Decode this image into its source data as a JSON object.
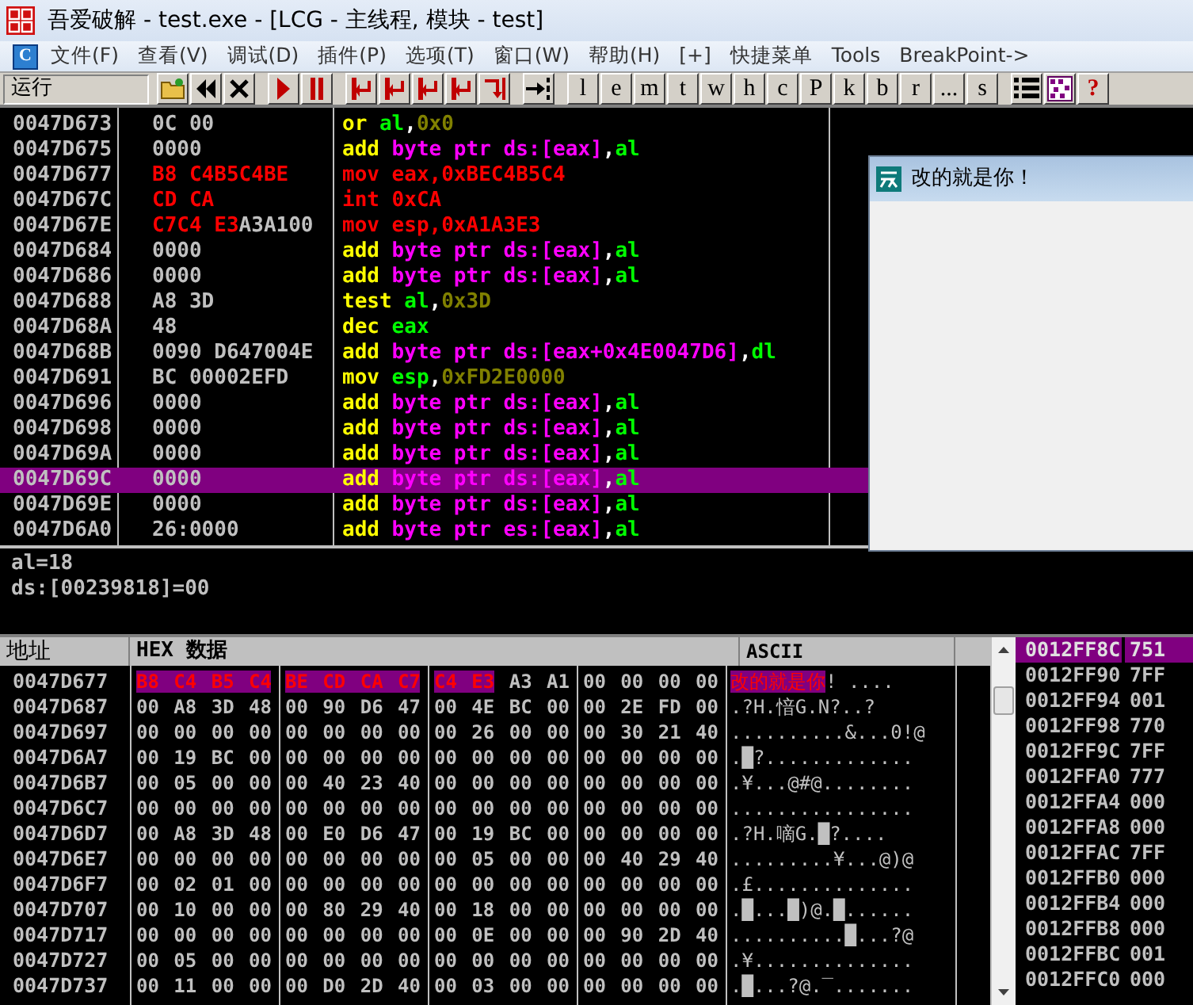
{
  "window": {
    "title": "吾爱破解 - test.exe - [LCG - 主线程, 模块 - test]"
  },
  "menu": {
    "logo": "C",
    "items": [
      "文件(F)",
      "查看(V)",
      "调试(D)",
      "插件(P)",
      "选项(T)",
      "窗口(W)",
      "帮助(H)",
      "[+]",
      "快捷菜单",
      "Tools",
      "BreakPoint->"
    ]
  },
  "toolbar": {
    "status": "运行",
    "groups": [
      [
        {
          "kind": "folder"
        },
        {
          "kind": "rewind"
        },
        {
          "kind": "cross"
        }
      ],
      [
        {
          "kind": "play"
        },
        {
          "kind": "pause"
        }
      ],
      [
        {
          "kind": "step"
        },
        {
          "kind": "step"
        },
        {
          "kind": "step"
        },
        {
          "kind": "step"
        },
        {
          "kind": "return"
        }
      ],
      [
        {
          "kind": "jump"
        }
      ],
      [
        {
          "kind": "letter",
          "label": "l"
        },
        {
          "kind": "letter",
          "label": "e"
        },
        {
          "kind": "letter",
          "label": "m"
        },
        {
          "kind": "letter",
          "label": "t"
        },
        {
          "kind": "letter",
          "label": "w"
        },
        {
          "kind": "letter",
          "label": "h"
        },
        {
          "kind": "letter",
          "label": "c"
        },
        {
          "kind": "letter",
          "label": "P"
        },
        {
          "kind": "letter",
          "label": "k"
        },
        {
          "kind": "letter",
          "label": "b"
        },
        {
          "kind": "letter",
          "label": "r"
        },
        {
          "kind": "letter",
          "label": "..."
        },
        {
          "kind": "letter",
          "label": "s"
        }
      ],
      [
        {
          "kind": "list"
        },
        {
          "kind": "grid"
        },
        {
          "kind": "help",
          "label": "?"
        }
      ]
    ]
  },
  "disasm": {
    "rows": [
      {
        "address": "0047D673",
        "hex": [
          {
            "text": "0C 00",
            "modified": false
          }
        ],
        "modified": false,
        "selected": false,
        "tokens": [
          {
            "text": "or",
            "kind": "op"
          },
          {
            "text": "al",
            "kind": "reg"
          },
          {
            "text": ",",
            "kind": "sep"
          },
          {
            "text": "0x0",
            "kind": "imm"
          }
        ]
      },
      {
        "address": "0047D675",
        "hex": [
          {
            "text": "0000",
            "modified": false
          }
        ],
        "modified": false,
        "selected": false,
        "tokens": [
          {
            "text": "add",
            "kind": "op"
          },
          {
            "text": "byte ptr ds:[eax]",
            "kind": "mem"
          },
          {
            "text": ",",
            "kind": "sep"
          },
          {
            "text": "al",
            "kind": "reg"
          }
        ]
      },
      {
        "address": "0047D677",
        "hex": [
          {
            "text": "B8 C4B5C4BE",
            "modified": true
          }
        ],
        "modified": true,
        "selected": false,
        "tokens": [
          {
            "text": "mov",
            "kind": "op"
          },
          {
            "text": "eax",
            "kind": "reg"
          },
          {
            "text": ",",
            "kind": "sep"
          },
          {
            "text": "0xBEC4B5C4",
            "kind": "imm"
          }
        ]
      },
      {
        "address": "0047D67C",
        "hex": [
          {
            "text": "CD CA",
            "modified": true
          }
        ],
        "modified": true,
        "selected": false,
        "tokens": [
          {
            "text": "int",
            "kind": "op"
          },
          {
            "text": "0xCA",
            "kind": "imm"
          }
        ]
      },
      {
        "address": "0047D67E",
        "hex": [
          {
            "text": "C7C4 E3",
            "modified": true
          },
          {
            "text": "A3A100",
            "modified": false
          }
        ],
        "modified": true,
        "selected": false,
        "tokens": [
          {
            "text": "mov",
            "kind": "op"
          },
          {
            "text": "esp",
            "kind": "reg"
          },
          {
            "text": ",",
            "kind": "sep"
          },
          {
            "text": "0xA1A3E3",
            "kind": "imm"
          }
        ]
      },
      {
        "address": "0047D684",
        "hex": [
          {
            "text": "0000",
            "modified": false
          }
        ],
        "modified": false,
        "selected": false,
        "tokens": [
          {
            "text": "add",
            "kind": "op"
          },
          {
            "text": "byte ptr ds:[eax]",
            "kind": "mem"
          },
          {
            "text": ",",
            "kind": "sep"
          },
          {
            "text": "al",
            "kind": "reg"
          }
        ]
      },
      {
        "address": "0047D686",
        "hex": [
          {
            "text": "0000",
            "modified": false
          }
        ],
        "modified": false,
        "selected": false,
        "tokens": [
          {
            "text": "add",
            "kind": "op"
          },
          {
            "text": "byte ptr ds:[eax]",
            "kind": "mem"
          },
          {
            "text": ",",
            "kind": "sep"
          },
          {
            "text": "al",
            "kind": "reg"
          }
        ]
      },
      {
        "address": "0047D688",
        "hex": [
          {
            "text": "A8 3D",
            "modified": false
          }
        ],
        "modified": false,
        "selected": false,
        "tokens": [
          {
            "text": "test",
            "kind": "op"
          },
          {
            "text": "al",
            "kind": "reg"
          },
          {
            "text": ",",
            "kind": "sep"
          },
          {
            "text": "0x3D",
            "kind": "imm"
          }
        ]
      },
      {
        "address": "0047D68A",
        "hex": [
          {
            "text": "48",
            "modified": false
          }
        ],
        "modified": false,
        "selected": false,
        "tokens": [
          {
            "text": "dec",
            "kind": "op"
          },
          {
            "text": "eax",
            "kind": "reg"
          }
        ]
      },
      {
        "address": "0047D68B",
        "hex": [
          {
            "text": "0090 D647004E",
            "modified": false
          }
        ],
        "modified": false,
        "selected": false,
        "tokens": [
          {
            "text": "add",
            "kind": "op"
          },
          {
            "text": "byte ptr ds:[eax+0x4E0047D6]",
            "kind": "mem"
          },
          {
            "text": ",",
            "kind": "sep"
          },
          {
            "text": "dl",
            "kind": "reg"
          }
        ]
      },
      {
        "address": "0047D691",
        "hex": [
          {
            "text": "BC 00002EFD",
            "modified": false
          }
        ],
        "modified": false,
        "selected": false,
        "tokens": [
          {
            "text": "mov",
            "kind": "op"
          },
          {
            "text": "esp",
            "kind": "reg"
          },
          {
            "text": ",",
            "kind": "sep"
          },
          {
            "text": "0xFD2E0000",
            "kind": "imm"
          }
        ]
      },
      {
        "address": "0047D696",
        "hex": [
          {
            "text": "0000",
            "modified": false
          }
        ],
        "modified": false,
        "selected": false,
        "tokens": [
          {
            "text": "add",
            "kind": "op"
          },
          {
            "text": "byte ptr ds:[eax]",
            "kind": "mem"
          },
          {
            "text": ",",
            "kind": "sep"
          },
          {
            "text": "al",
            "kind": "reg"
          }
        ]
      },
      {
        "address": "0047D698",
        "hex": [
          {
            "text": "0000",
            "modified": false
          }
        ],
        "modified": false,
        "selected": false,
        "tokens": [
          {
            "text": "add",
            "kind": "op"
          },
          {
            "text": "byte ptr ds:[eax]",
            "kind": "mem"
          },
          {
            "text": ",",
            "kind": "sep"
          },
          {
            "text": "al",
            "kind": "reg"
          }
        ]
      },
      {
        "address": "0047D69A",
        "hex": [
          {
            "text": "0000",
            "modified": false
          }
        ],
        "modified": false,
        "selected": false,
        "tokens": [
          {
            "text": "add",
            "kind": "op"
          },
          {
            "text": "byte ptr ds:[eax]",
            "kind": "mem"
          },
          {
            "text": ",",
            "kind": "sep"
          },
          {
            "text": "al",
            "kind": "reg"
          }
        ]
      },
      {
        "address": "0047D69C",
        "hex": [
          {
            "text": "0000",
            "modified": false
          }
        ],
        "modified": false,
        "selected": true,
        "tokens": [
          {
            "text": "add",
            "kind": "op"
          },
          {
            "text": "byte ptr ds:[eax]",
            "kind": "mem"
          },
          {
            "text": ",",
            "kind": "sep"
          },
          {
            "text": "al",
            "kind": "reg"
          }
        ]
      },
      {
        "address": "0047D69E",
        "hex": [
          {
            "text": "0000",
            "modified": false
          }
        ],
        "modified": false,
        "selected": false,
        "tokens": [
          {
            "text": "add",
            "kind": "op"
          },
          {
            "text": "byte ptr ds:[eax]",
            "kind": "mem"
          },
          {
            "text": ",",
            "kind": "sep"
          },
          {
            "text": "al",
            "kind": "reg"
          }
        ]
      },
      {
        "address": "0047D6A0",
        "hex": [
          {
            "text": "26:0000",
            "modified": false
          }
        ],
        "modified": false,
        "selected": false,
        "tokens": [
          {
            "text": "add",
            "kind": "op"
          },
          {
            "text": "byte ptr es:[eax]",
            "kind": "mem"
          },
          {
            "text": ",",
            "kind": "sep"
          },
          {
            "text": "al",
            "kind": "reg"
          }
        ]
      }
    ]
  },
  "info": [
    "al=18",
    "ds:[00239818]=00"
  ],
  "dump": {
    "columns": [
      "地址",
      "HEX 数据",
      "ASCII"
    ],
    "rows": [
      {
        "address": "0047D677",
        "groups": [
          [
            {
              "text": "B8 C4 B5 C4",
              "modified": true
            }
          ],
          [
            {
              "text": "BE CD CA C7",
              "modified": true
            }
          ],
          [
            {
              "text": "C4 E3",
              "modified": true
            },
            {
              "text": "A3 A1",
              "modified": false
            }
          ],
          [
            {
              "text": "00 00 00 00",
              "modified": false
            }
          ]
        ],
        "ascii": [
          {
            "text": "改的就是你",
            "modified": true
          },
          {
            "text": "! ....",
            "modified": false
          }
        ]
      },
      {
        "address": "0047D687",
        "groups": [
          [
            {
              "text": "00 A8 3D 48",
              "modified": false
            }
          ],
          [
            {
              "text": "00 90 D6 47",
              "modified": false
            }
          ],
          [
            {
              "text": "00 4E BC 00",
              "modified": false
            }
          ],
          [
            {
              "text": "00 2E FD 00",
              "modified": false
            }
          ]
        ],
        "ascii": [
          {
            "text": ".?H.愔G.N?..?",
            "modified": false
          }
        ]
      },
      {
        "address": "0047D697",
        "groups": [
          [
            {
              "text": "00 00 00 00",
              "modified": false
            }
          ],
          [
            {
              "text": "00 00 00 00",
              "modified": false
            }
          ],
          [
            {
              "text": "00 26 00 00",
              "modified": false
            }
          ],
          [
            {
              "text": "00 30 21 40",
              "modified": false
            }
          ]
        ],
        "ascii": [
          {
            "text": "..........&...0!@",
            "modified": false
          }
        ]
      },
      {
        "address": "0047D6A7",
        "groups": [
          [
            {
              "text": "00 19 BC 00",
              "modified": false
            }
          ],
          [
            {
              "text": "00 00 00 00",
              "modified": false
            }
          ],
          [
            {
              "text": "00 00 00 00",
              "modified": false
            }
          ],
          [
            {
              "text": "00 00 00 00",
              "modified": false
            }
          ]
        ],
        "ascii": [
          {
            "text": ".█?.............",
            "modified": false
          }
        ]
      },
      {
        "address": "0047D6B7",
        "groups": [
          [
            {
              "text": "00 05 00 00",
              "modified": false
            }
          ],
          [
            {
              "text": "00 40 23 40",
              "modified": false
            }
          ],
          [
            {
              "text": "00 00 00 00",
              "modified": false
            }
          ],
          [
            {
              "text": "00 00 00 00",
              "modified": false
            }
          ]
        ],
        "ascii": [
          {
            "text": ".¥...@#@........",
            "modified": false
          }
        ]
      },
      {
        "address": "0047D6C7",
        "groups": [
          [
            {
              "text": "00 00 00 00",
              "modified": false
            }
          ],
          [
            {
              "text": "00 00 00 00",
              "modified": false
            }
          ],
          [
            {
              "text": "00 00 00 00",
              "modified": false
            }
          ],
          [
            {
              "text": "00 00 00 00",
              "modified": false
            }
          ]
        ],
        "ascii": [
          {
            "text": "................",
            "modified": false
          }
        ]
      },
      {
        "address": "0047D6D7",
        "groups": [
          [
            {
              "text": "00 A8 3D 48",
              "modified": false
            }
          ],
          [
            {
              "text": "00 E0 D6 47",
              "modified": false
            }
          ],
          [
            {
              "text": "00 19 BC 00",
              "modified": false
            }
          ],
          [
            {
              "text": "00 00 00 00",
              "modified": false
            }
          ]
        ],
        "ascii": [
          {
            "text": ".?H.嘀G.█?....",
            "modified": false
          }
        ]
      },
      {
        "address": "0047D6E7",
        "groups": [
          [
            {
              "text": "00 00 00 00",
              "modified": false
            }
          ],
          [
            {
              "text": "00 00 00 00",
              "modified": false
            }
          ],
          [
            {
              "text": "00 05 00 00",
              "modified": false
            }
          ],
          [
            {
              "text": "00 40 29 40",
              "modified": false
            }
          ]
        ],
        "ascii": [
          {
            "text": ".........¥...@)@",
            "modified": false
          }
        ]
      },
      {
        "address": "0047D6F7",
        "groups": [
          [
            {
              "text": "00 02 01 00",
              "modified": false
            }
          ],
          [
            {
              "text": "00 00 00 00",
              "modified": false
            }
          ],
          [
            {
              "text": "00 00 00 00",
              "modified": false
            }
          ],
          [
            {
              "text": "00 00 00 00",
              "modified": false
            }
          ]
        ],
        "ascii": [
          {
            "text": ".£..............",
            "modified": false
          }
        ]
      },
      {
        "address": "0047D707",
        "groups": [
          [
            {
              "text": "00 10 00 00",
              "modified": false
            }
          ],
          [
            {
              "text": "00 80 29 40",
              "modified": false
            }
          ],
          [
            {
              "text": "00 18 00 00",
              "modified": false
            }
          ],
          [
            {
              "text": "00 00 00 00",
              "modified": false
            }
          ]
        ],
        "ascii": [
          {
            "text": ".█...█)@.█......",
            "modified": false
          }
        ]
      },
      {
        "address": "0047D717",
        "groups": [
          [
            {
              "text": "00 00 00 00",
              "modified": false
            }
          ],
          [
            {
              "text": "00 00 00 00",
              "modified": false
            }
          ],
          [
            {
              "text": "00 0E 00 00",
              "modified": false
            }
          ],
          [
            {
              "text": "00 90 2D 40",
              "modified": false
            }
          ]
        ],
        "ascii": [
          {
            "text": "..........█...?@",
            "modified": false
          }
        ]
      },
      {
        "address": "0047D727",
        "groups": [
          [
            {
              "text": "00 05 00 00",
              "modified": false
            }
          ],
          [
            {
              "text": "00 00 00 00",
              "modified": false
            }
          ],
          [
            {
              "text": "00 00 00 00",
              "modified": false
            }
          ],
          [
            {
              "text": "00 00 00 00",
              "modified": false
            }
          ]
        ],
        "ascii": [
          {
            "text": ".¥..............",
            "modified": false
          }
        ]
      },
      {
        "address": "0047D737",
        "groups": [
          [
            {
              "text": "00 11 00 00",
              "modified": false
            }
          ],
          [
            {
              "text": "00 D0 2D 40",
              "modified": false
            }
          ],
          [
            {
              "text": "00 03 00 00",
              "modified": false
            }
          ],
          [
            {
              "text": "00 00 00 00",
              "modified": false
            }
          ]
        ],
        "ascii": [
          {
            "text": ".█...?@.‾.......",
            "modified": false
          }
        ]
      }
    ]
  },
  "stack": {
    "rows": [
      {
        "address": "0012FF8C",
        "value": "751",
        "selected": true
      },
      {
        "address": "0012FF90",
        "value": "7FF",
        "selected": false
      },
      {
        "address": "0012FF94",
        "value": "001",
        "selected": false
      },
      {
        "address": "0012FF98",
        "value": "770",
        "selected": false
      },
      {
        "address": "0012FF9C",
        "value": "7FF",
        "selected": false
      },
      {
        "address": "0012FFA0",
        "value": "777",
        "selected": false
      },
      {
        "address": "0012FFA4",
        "value": "000",
        "selected": false
      },
      {
        "address": "0012FFA8",
        "value": "000",
        "selected": false
      },
      {
        "address": "0012FFAC",
        "value": "7FF",
        "selected": false
      },
      {
        "address": "0012FFB0",
        "value": "000",
        "selected": false
      },
      {
        "address": "0012FFB4",
        "value": "000",
        "selected": false
      },
      {
        "address": "0012FFB8",
        "value": "000",
        "selected": false
      },
      {
        "address": "0012FFBC",
        "value": "001",
        "selected": false
      },
      {
        "address": "0012FFC0",
        "value": "000",
        "selected": false
      }
    ]
  },
  "dialog": {
    "title": "改的就是你！"
  }
}
